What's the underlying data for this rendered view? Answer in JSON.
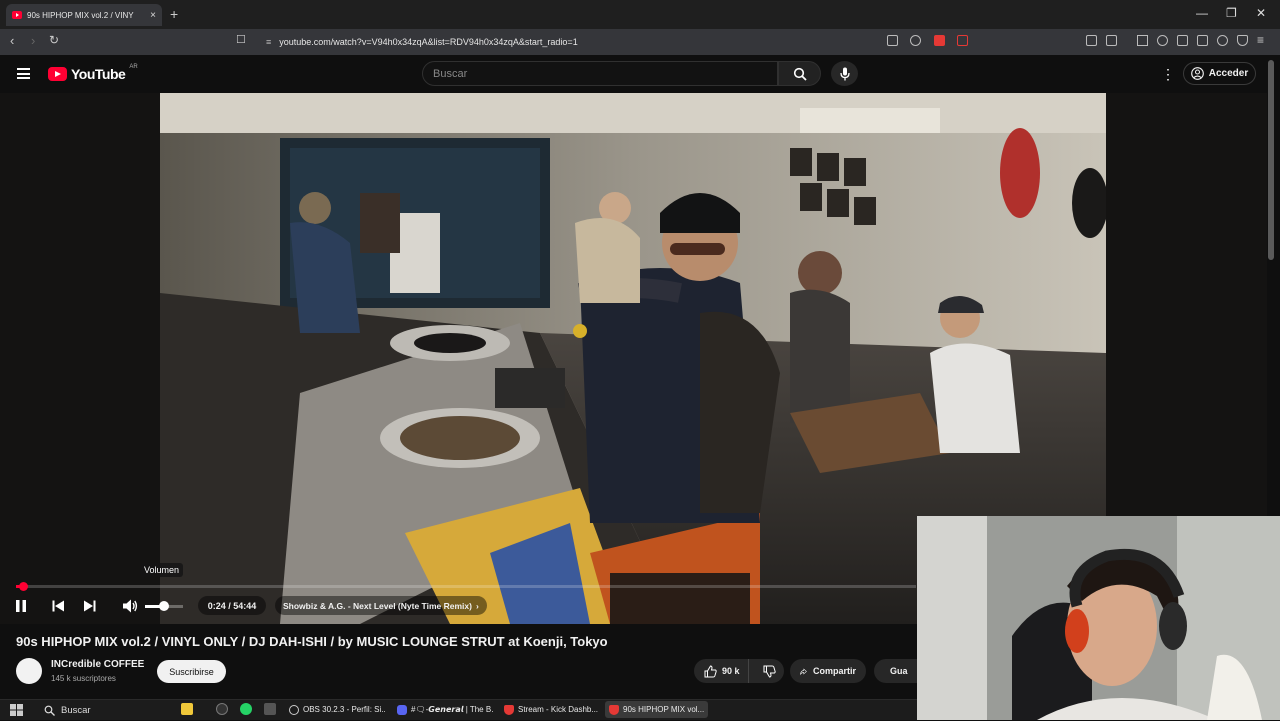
{
  "browser": {
    "tab_title": "90s HIPHOP MIX vol.2 / VINY",
    "tab_close": "×",
    "new_tab": "+",
    "url": "youtube.com/watch?v=V94h0x34zqA&list=RDV94h0x34zqA&start_radio=1",
    "window_controls": [
      "—",
      "❐",
      "✕"
    ]
  },
  "youtube": {
    "logo_text": "YouTube",
    "region": "AR",
    "search_placeholder": "Buscar",
    "signin_label": "Acceder"
  },
  "player": {
    "progress_fraction": 0.0073,
    "volume_fraction": 0.5,
    "volume_tooltip": "Volumen",
    "time_display": "0:24 / 54:44",
    "chapter": "Showbiz & A.G. - Next Level (Nyte Time Remix)",
    "chapter_arrow": "›"
  },
  "video": {
    "title": "90s HIPHOP MIX vol.2 / VINYL ONLY / DJ DAH-ISHI / by MUSIC LOUNGE STRUT at Koenji, Tokyo",
    "channel_name": "INCredible COFFEE",
    "subscribers": "145 k suscriptores",
    "subscribe_label": "Suscribirse",
    "like_count": "90 k",
    "share_label": "Compartir",
    "save_label": "Gua"
  },
  "taskbar": {
    "search_label": "Buscar",
    "apps": [
      {
        "label": "OBS 30.2.3 - Perfil: Si...",
        "color": "#4a4a4a"
      },
      {
        "label": "#🗨-𝙂𝙚𝙣𝙚𝙧𝙖𝙡 | The B...",
        "color": "#5865f2"
      },
      {
        "label": "Stream - Kick Dashb...",
        "color": "#e53935"
      },
      {
        "label": "90s HIPHOP MIX vol...",
        "color": "#e53935"
      }
    ]
  },
  "colors": {
    "youtube_red": "#ff0033",
    "background": "#0f0f0f"
  }
}
